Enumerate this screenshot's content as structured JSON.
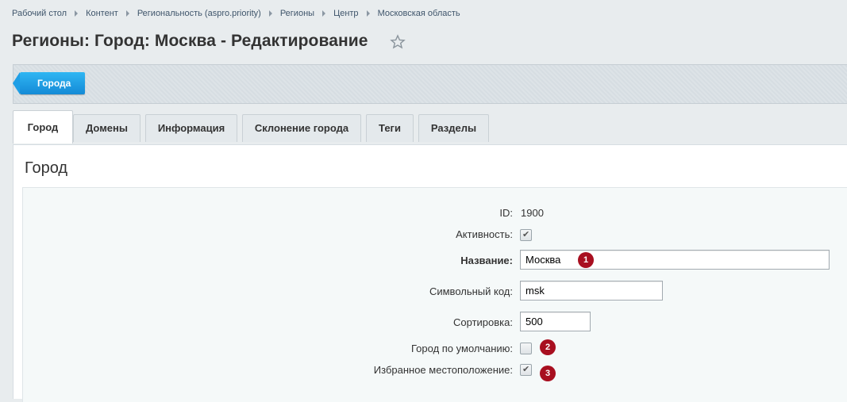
{
  "breadcrumb": [
    "Рабочий стол",
    "Контент",
    "Региональность (aspro.priority)",
    "Регионы",
    "Центр",
    "Московская область"
  ],
  "page_title": "Регионы: Город: Москва - Редактирование",
  "toolbar": {
    "back_button": "Города"
  },
  "tabs": [
    "Город",
    "Домены",
    "Информация",
    "Склонение города",
    "Теги",
    "Разделы"
  ],
  "active_tab": "Город",
  "section_title": "Город",
  "form": {
    "id_label": "ID:",
    "id_value": "1900",
    "active_label": "Активность:",
    "active_checked": true,
    "name_label": "Название:",
    "name_value": "Москва",
    "code_label": "Символьный код:",
    "code_value": "msk",
    "sort_label": "Сортировка:",
    "sort_value": "500",
    "default_label": "Город по умолчанию:",
    "default_checked": false,
    "favorite_label": "Избранное местоположение:",
    "favorite_checked": true
  },
  "markers": [
    "1",
    "2",
    "3"
  ],
  "icons": {
    "favorite": "star-icon",
    "check": "check-icon"
  },
  "colors": {
    "accent": "#1b9ae0",
    "marker": "#a80f20"
  }
}
